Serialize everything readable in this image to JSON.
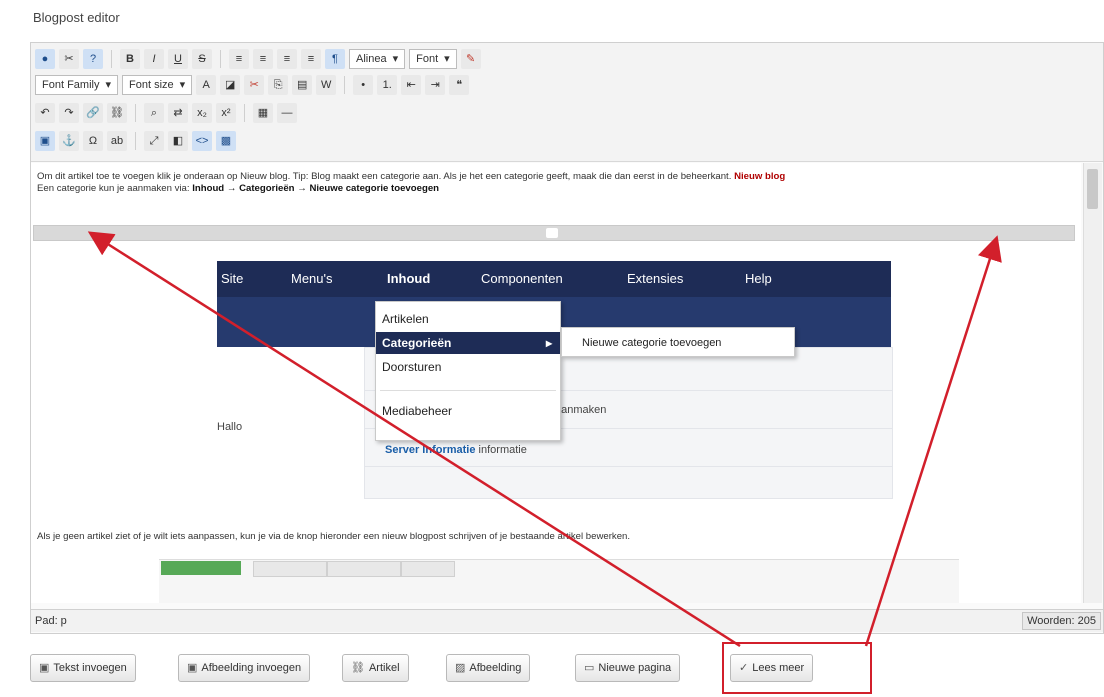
{
  "page": {
    "title": "Blogpost editor"
  },
  "toolbar": {
    "format_select": "Alinea",
    "font_select": "Font",
    "font_family": "Font Family",
    "font_size": "Font size"
  },
  "content": {
    "para1_a": "Om dit artikel toe te voegen klik je onderaan op Nieuw blog. Tip: Blog maakt een categorie aan. Als je het een categorie geeft, maak die dan eerst in de beheerkant.",
    "para1_link": "Nieuw blog",
    "para1_b": "Een categorie kun je aanmaken via:",
    "para1_path": "Inhoud → Categorieën → Nieuwe categorie toevoegen",
    "nav": [
      "Site",
      "Menu's",
      "Inhoud",
      "Componenten",
      "Extensies",
      "Help"
    ],
    "dropdown": [
      "Artikelen",
      "Categorieën",
      "Doorsturen",
      "Mediabeheer"
    ],
    "submenu": "Nieuwe categorie toevoegen",
    "link_row_1": "Server Informatie",
    "link_row_1_tail": "informatie",
    "left_stub": "Hallo",
    "row_tail": "aanmaken",
    "para2": "Als je geen artikel ziet of je wilt iets aanpassen, kun je via de knop hieronder een nieuw blogpost schrijven of je bestaande artikel bewerken."
  },
  "statusbar": {
    "path": "Pad: p",
    "words": "Woorden: 205"
  },
  "buttons": [
    {
      "label": "Tekst invoegen",
      "icon": "image-icon"
    },
    {
      "label": "Afbeelding invoegen",
      "icon": "image-icon"
    },
    {
      "label": "Artikel",
      "icon": "link-icon"
    },
    {
      "label": "Afbeelding",
      "icon": "picture-icon"
    },
    {
      "label": "Nieuwe pagina",
      "icon": "page-icon"
    },
    {
      "label": "Lees meer",
      "icon": "check-icon"
    }
  ],
  "colors": {
    "navbar": "#1e2c56",
    "annotation": "#d21f2b",
    "highlight_box": "#d21f2b"
  }
}
